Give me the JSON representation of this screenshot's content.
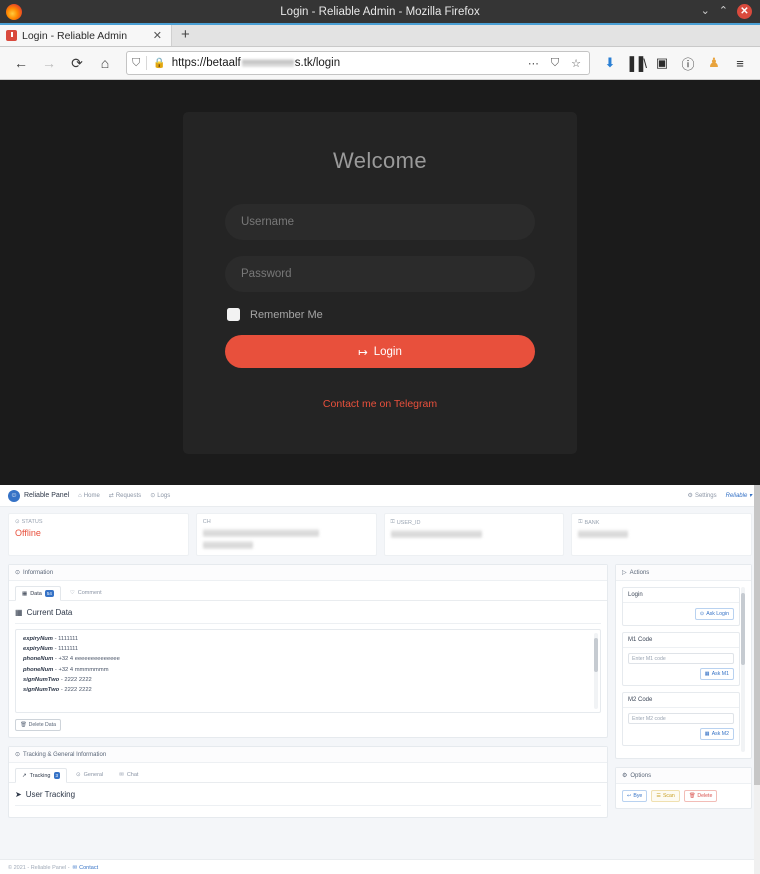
{
  "window": {
    "title": "Login - Reliable Admin - Mozilla Firefox",
    "minimize": "⌄",
    "maximize": "⌃",
    "close": "✕"
  },
  "browser": {
    "tab": {
      "title": "Login - Reliable Admin",
      "close": "✕"
    },
    "new_tab": "+",
    "nav": {
      "back": "←",
      "forward": "→",
      "reload": "⟳",
      "home": "⌂"
    },
    "url": {
      "prefix": "https://betaalf",
      "suffix": "s.tk/login",
      "shield_icon": "⛉",
      "lock_icon": "🔒",
      "page_actions": "⋯",
      "reader_icon": "⛉",
      "bookmark_icon": "☆"
    },
    "toolbar": {
      "downloads": "⬇",
      "library": "▐▐\\",
      "sidebar": "▣",
      "account": "ⓘ",
      "extension": "♟",
      "menu": "≡"
    }
  },
  "login": {
    "heading": "Welcome",
    "username_placeholder": "Username",
    "password_placeholder": "Password",
    "remember_label": "Remember Me",
    "login_button": "Login",
    "login_icon": "↦",
    "telegram_link": "Contact me on Telegram",
    "accent_color": "#e8503c",
    "background_color": "#1b1b1b",
    "card_color": "#242424"
  },
  "admin": {
    "brand": {
      "name": "Reliable Panel",
      "avatar_icon": "☺"
    },
    "nav_links": [
      {
        "label": "Home",
        "icon": "⌂"
      },
      {
        "label": "Requests",
        "icon": "⇄"
      },
      {
        "label": "Logs",
        "icon": "⊙"
      }
    ],
    "nav_right": [
      {
        "label": "Settings",
        "icon": "⚙"
      }
    ],
    "user_menu": {
      "label": "Reliable",
      "caret": "▾"
    },
    "stats": [
      {
        "label": "STATUS",
        "icon": "⊙",
        "value": "Offline",
        "redacted": false
      },
      {
        "label": "CH",
        "icon": "",
        "value": "",
        "redacted": true
      },
      {
        "label": "USER_ID",
        "icon": "⚿",
        "value": "",
        "redacted": true
      },
      {
        "label": "BANK",
        "icon": "⚿",
        "value": "",
        "redacted": true
      }
    ],
    "information": {
      "panel_title": "Information",
      "panel_icon": "⊙",
      "tabs": [
        {
          "label": "Data",
          "icon": "▦",
          "badge": "54",
          "active": true
        },
        {
          "label": "Comment",
          "icon": "♡",
          "badge": "",
          "active": false
        }
      ],
      "section_title": "Current Data",
      "section_icon": "▦",
      "rows": [
        {
          "key": "expiryNum",
          "value": "1111111"
        },
        {
          "key": "expiryNum",
          "value": "1111111"
        },
        {
          "key": "phoneNum",
          "value": "+32 4 eeeeeeeeeeeeee"
        },
        {
          "key": "phoneNum",
          "value": "+32 4 mmmmmmm"
        },
        {
          "key": "signNumTwo",
          "value": "2222 2222"
        },
        {
          "key": "signNumTwo",
          "value": "2222 2222"
        }
      ],
      "delete_button": "Delete Data",
      "delete_icon": "🗑"
    },
    "tracking": {
      "panel_title": "Tracking & General Information",
      "panel_icon": "⊙",
      "tabs": [
        {
          "label": "Tracking",
          "icon": "↗",
          "badge": "3",
          "active": true
        },
        {
          "label": "General",
          "icon": "⊙",
          "badge": "",
          "active": false
        },
        {
          "label": "Chat",
          "icon": "✉",
          "badge": "",
          "active": false
        }
      ],
      "section_title": "User Tracking",
      "section_icon": "➤"
    },
    "actions": {
      "panel_title": "Actions",
      "panel_icon": "▷",
      "cards": [
        {
          "title": "Login",
          "placeholder": "",
          "button": "Ask Login",
          "button_icon": "⊙",
          "has_input": false
        },
        {
          "title": "M1 Code",
          "placeholder": "Enter M1 code",
          "button": "Ask M1",
          "button_icon": "▦",
          "has_input": true
        },
        {
          "title": "M2 Code",
          "placeholder": "Enter M2 code",
          "button": "Ask M2",
          "button_icon": "▦",
          "has_input": true
        }
      ]
    },
    "options": {
      "panel_title": "Options",
      "panel_icon": "⚙",
      "buttons": [
        {
          "label": "Bye",
          "icon": "↩",
          "style": "blue"
        },
        {
          "label": "Scan",
          "icon": "☰",
          "style": "warn"
        },
        {
          "label": "Delete",
          "icon": "🗑",
          "style": "red"
        }
      ]
    },
    "footer": {
      "copyright": "© 2021 - Reliable Panel -",
      "contact": "Contact",
      "contact_icon": "✉"
    }
  }
}
